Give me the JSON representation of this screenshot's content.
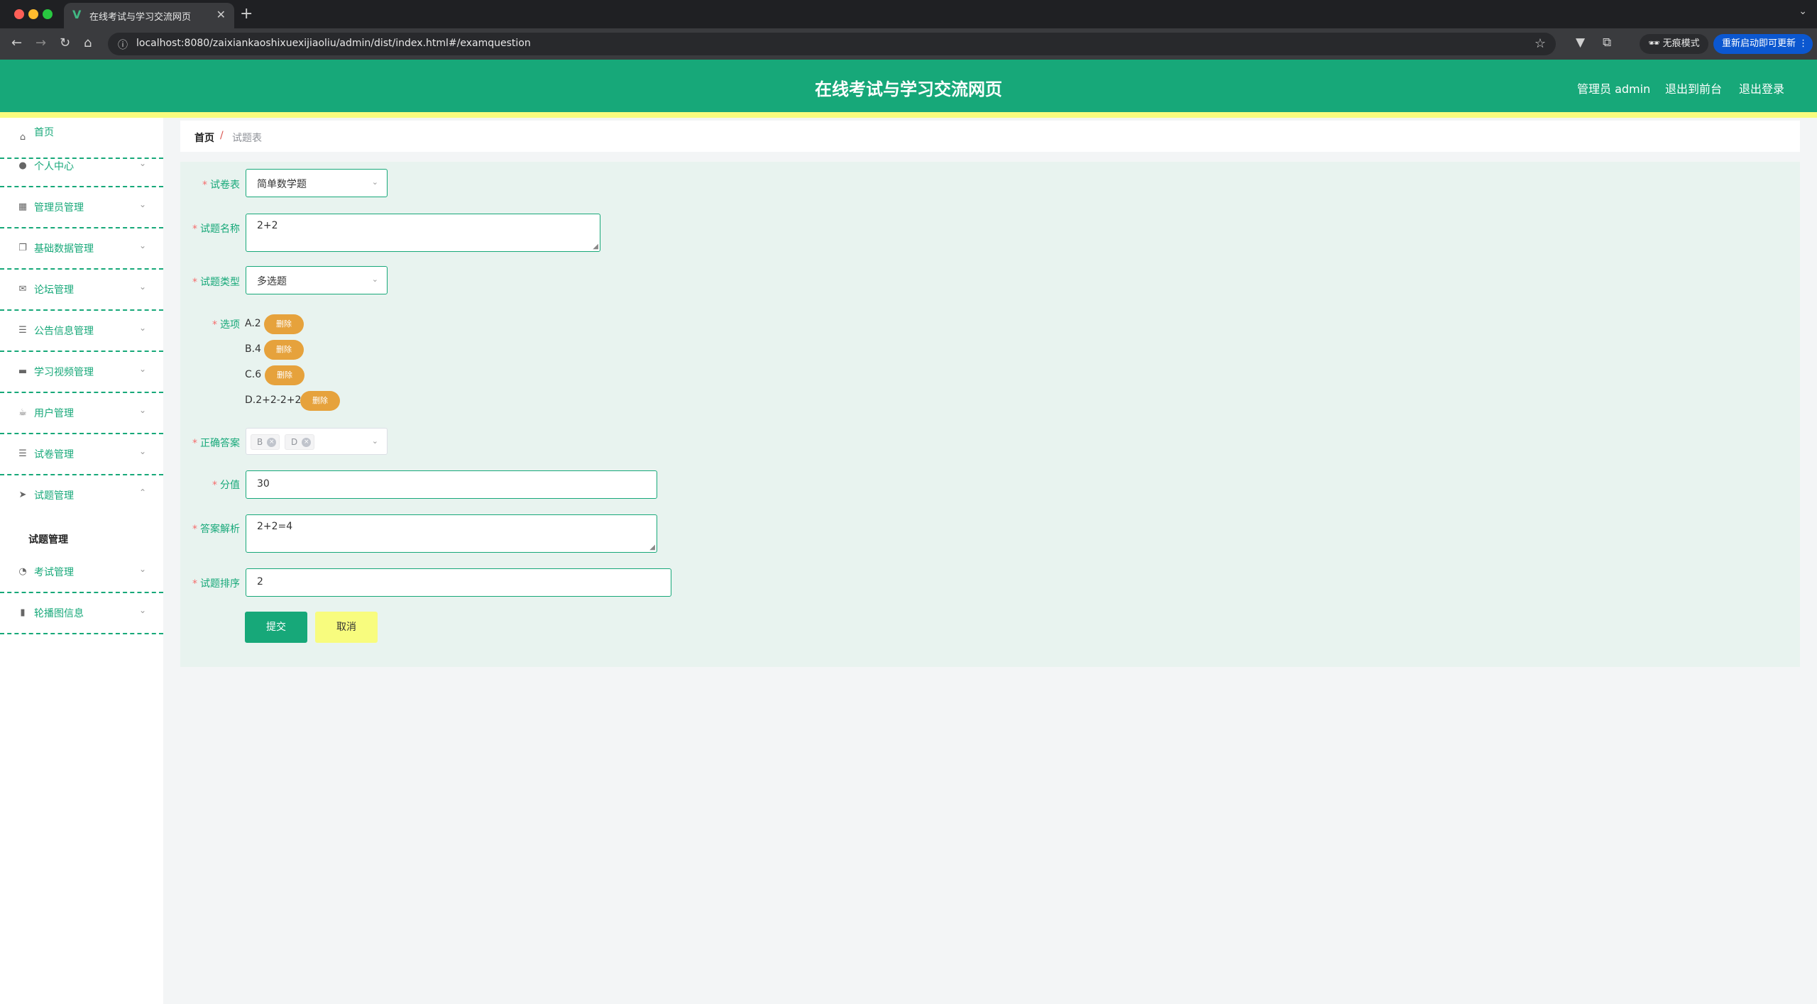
{
  "browser": {
    "tab_title": "在线考试与学习交流网页",
    "tab_favicon": "V",
    "url": "localhost:8080/zaixiankaoshixuexijiaoliu/admin/dist/index.html#/examquestion",
    "incognito_label": "无痕模式",
    "relaunch_label": "重新启动即可更新"
  },
  "header": {
    "title": "在线考试与学习交流网页",
    "user_label": "管理员 admin",
    "front_link": "退出到前台",
    "logout_link": "退出登录"
  },
  "sidebar": {
    "items": [
      {
        "label": "首页",
        "icon": "home-icon"
      },
      {
        "label": "个人中心",
        "icon": "user-icon"
      },
      {
        "label": "管理员管理",
        "icon": "grid-icon"
      },
      {
        "label": "基础数据管理",
        "icon": "copy-icon"
      },
      {
        "label": "论坛管理",
        "icon": "mail-icon"
      },
      {
        "label": "公告信息管理",
        "icon": "list-icon"
      },
      {
        "label": "学习视频管理",
        "icon": "monitor-icon"
      },
      {
        "label": "用户管理",
        "icon": "coffee-icon"
      },
      {
        "label": "试卷管理",
        "icon": "list-icon"
      },
      {
        "label": "试题管理",
        "icon": "send-icon"
      },
      {
        "label": "考试管理",
        "icon": "gauge-icon"
      },
      {
        "label": "轮播图信息",
        "icon": "chart-icon"
      }
    ],
    "sub_item_label": "试题管理"
  },
  "breadcrumb": {
    "home": "首页",
    "separator": "/",
    "current": "试题表"
  },
  "form": {
    "paper_label": "试卷表",
    "paper_value": "简单数学题",
    "name_label": "试题名称",
    "name_value": "2+2",
    "type_label": "试题类型",
    "type_value": "多选题",
    "options_label": "选项",
    "options": [
      {
        "text": "A.2",
        "delete": "删除"
      },
      {
        "text": "B.4",
        "delete": "删除"
      },
      {
        "text": "C.6",
        "delete": "删除"
      },
      {
        "text": "D.2+2-2+2",
        "delete": "删除"
      }
    ],
    "answer_label": "正确答案",
    "answer_tags": [
      "B",
      "D"
    ],
    "score_label": "分值",
    "score_value": "30",
    "analysis_label": "答案解析",
    "analysis_value": "2+2=4",
    "order_label": "试题排序",
    "order_value": "2",
    "submit_label": "提交",
    "cancel_label": "取消"
  },
  "colors": {
    "primary": "#17a879",
    "accent_yellow": "#f8fc7e",
    "delete_orange": "#e6a23c",
    "required_red": "#f56c6c"
  }
}
